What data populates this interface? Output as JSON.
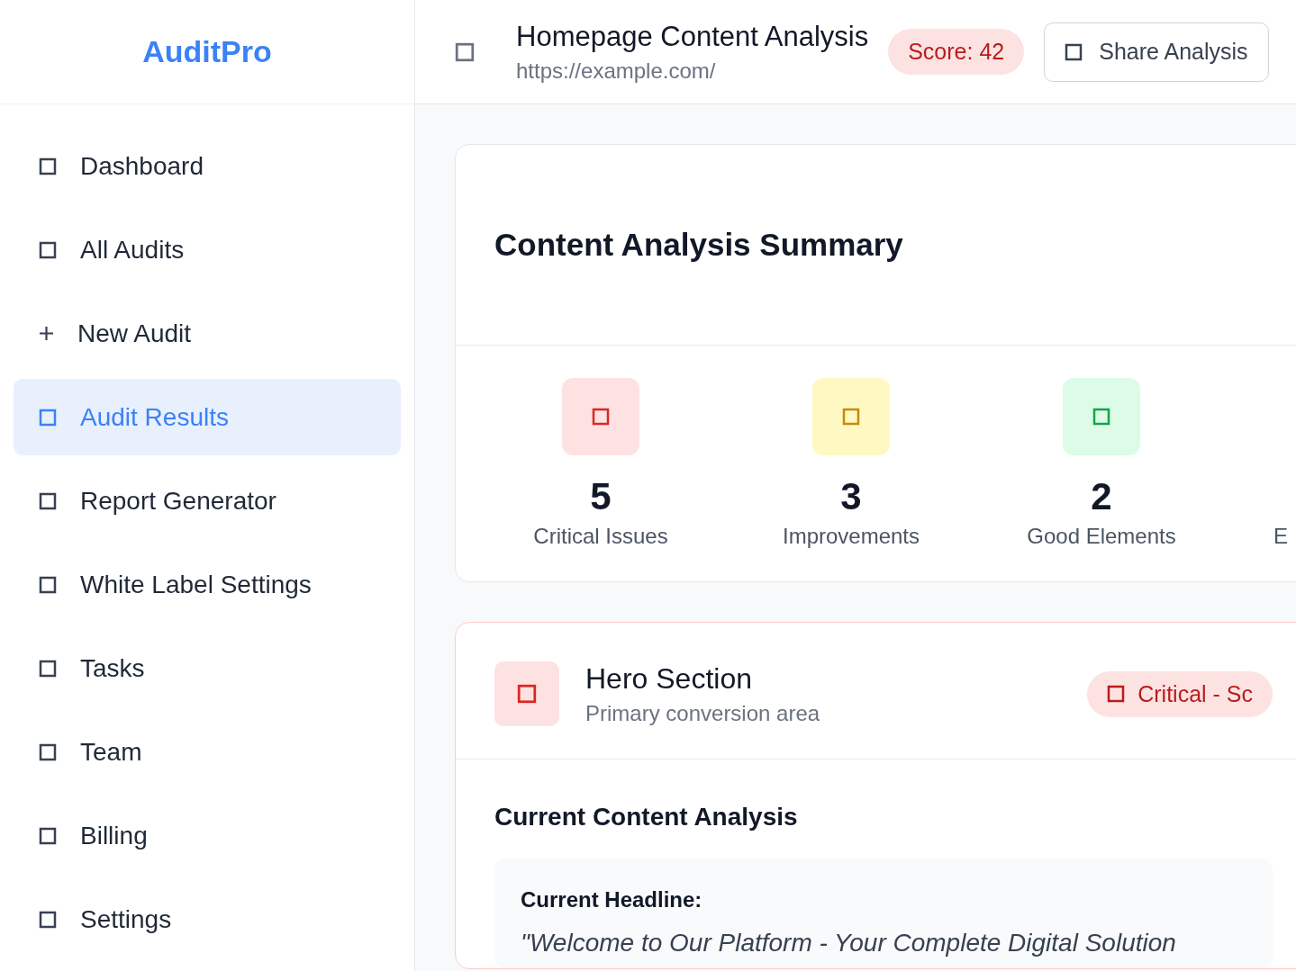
{
  "sidebar": {
    "logo": "AuditPro",
    "items": [
      {
        "label": "Dashboard",
        "kind": "square",
        "selected": false
      },
      {
        "label": "All Audits",
        "kind": "square",
        "selected": false
      },
      {
        "label": "New Audit",
        "kind": "plus",
        "selected": false
      },
      {
        "label": "Audit Results",
        "kind": "square",
        "selected": true
      },
      {
        "label": "Report Generator",
        "kind": "square",
        "selected": false
      },
      {
        "label": "White Label Settings",
        "kind": "square",
        "selected": false
      },
      {
        "label": "Tasks",
        "kind": "square",
        "selected": false
      },
      {
        "label": "Team",
        "kind": "square",
        "selected": false
      },
      {
        "label": "Billing",
        "kind": "square",
        "selected": false
      },
      {
        "label": "Settings",
        "kind": "square",
        "selected": false
      }
    ]
  },
  "header": {
    "title": "Homepage Content Analysis",
    "url": "https://example.com/",
    "score": "Score: 42",
    "share_button": "Share Analysis"
  },
  "summary": {
    "title": "Content Analysis Summary",
    "stats": [
      {
        "value": "5",
        "label": "Critical Issues",
        "color": "#dc2626"
      },
      {
        "value": "3",
        "label": "Improvements",
        "color": "#ca8a04"
      },
      {
        "value": "2",
        "label": "Good Elements",
        "color": "#16a34a"
      },
      {
        "label": "E"
      }
    ]
  },
  "section": {
    "title": "Hero Section",
    "subtitle": "Primary conversion area",
    "badge": "Critical - Sc",
    "analysis_title": "Current Content Analysis",
    "headline_label": "Current Headline:",
    "headline": "\"Welcome to Our Platform - Your Complete Digital Solution"
  }
}
